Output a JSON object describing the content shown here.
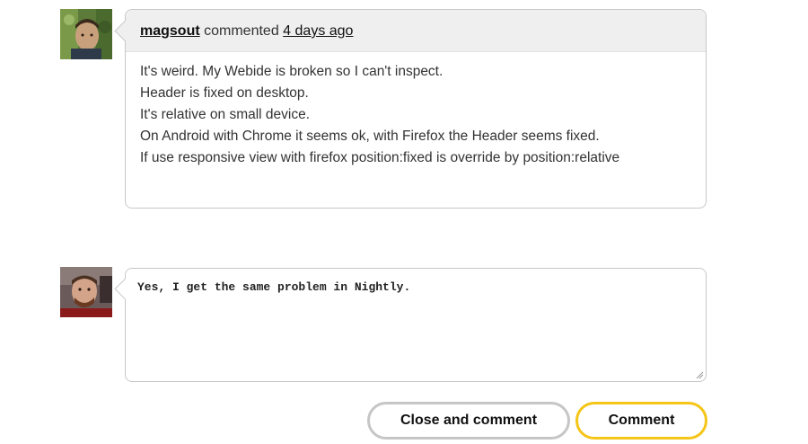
{
  "comment": {
    "author": "magsout",
    "action": "commented",
    "time": "4 days ago",
    "lines": [
      "It's weird. My Webide is broken so I can't inspect.",
      "Header is fixed on desktop.",
      "It's relative on small device.",
      "On Android with Chrome it seems ok, with Firefox the Header seems fixed.",
      "If use responsive view with firefox position:fixed is override by position:relative"
    ]
  },
  "reply": {
    "value": "Yes, I get the same problem in Nightly."
  },
  "buttons": {
    "close_and_comment": "Close and comment",
    "comment": "Comment"
  },
  "colors": {
    "accent": "#f5c518",
    "secondary_border": "#c6c6c6",
    "header_bg": "#efefef"
  }
}
